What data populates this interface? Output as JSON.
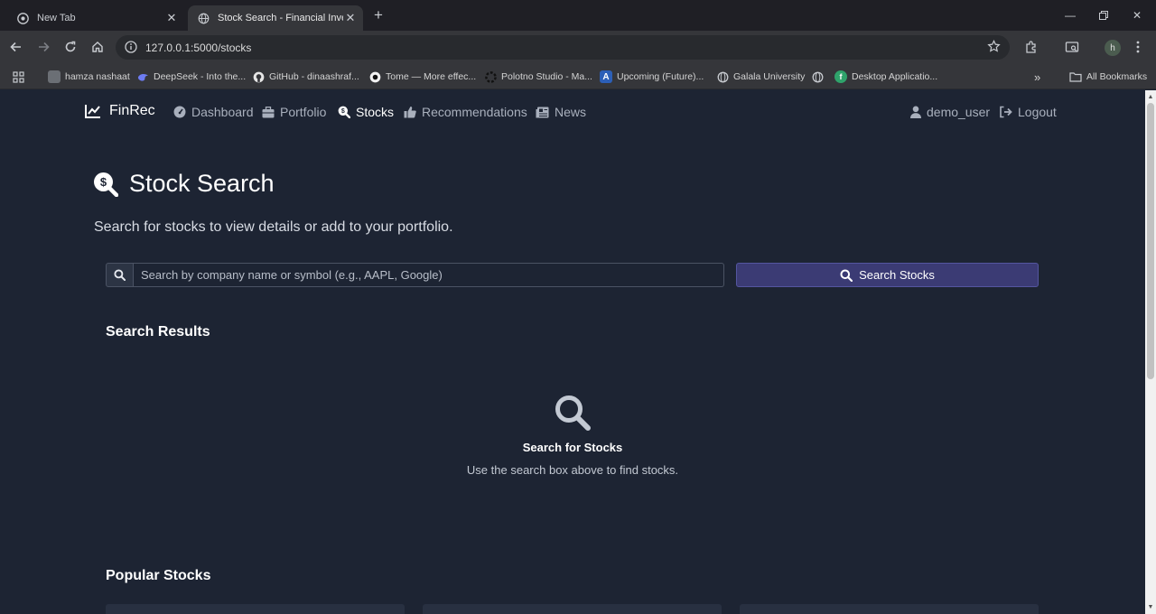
{
  "browser": {
    "tabs": [
      {
        "title": "New Tab"
      },
      {
        "title": "Stock Search - Financial Investm"
      }
    ],
    "url": "127.0.0.1:5000/stocks",
    "profile_initial": "h",
    "bookmarks": [
      {
        "label": "hamza nashaat",
        "icon": "image-icon"
      },
      {
        "label": "DeepSeek - Into the...",
        "icon": "deepseek-icon"
      },
      {
        "label": "GitHub - dinaashraf...",
        "icon": "github-icon"
      },
      {
        "label": "Tome — More effec...",
        "icon": "tome-icon"
      },
      {
        "label": "Polotno Studio - Ma...",
        "icon": "polotno-icon"
      },
      {
        "label": "Upcoming (Future)...",
        "icon": "upcoming-icon"
      },
      {
        "label": "Galala University",
        "icon": "globe-icon"
      },
      {
        "label": "Desktop Applicatio...",
        "icon": "desktop-app-icon"
      }
    ],
    "all_bookmarks_label": "All Bookmarks"
  },
  "nav": {
    "brand": "FinRec",
    "links": [
      {
        "label": "Dashboard",
        "icon": "dashboard-icon"
      },
      {
        "label": "Portfolio",
        "icon": "briefcase-icon"
      },
      {
        "label": "Stocks",
        "icon": "search-dollar-icon"
      },
      {
        "label": "Recommendations",
        "icon": "thumbs-up-icon"
      },
      {
        "label": "News",
        "icon": "newspaper-icon"
      }
    ],
    "user": "demo_user",
    "logout": "Logout"
  },
  "page": {
    "title": "Stock Search",
    "lead": "Search for stocks to view details or add to your portfolio.",
    "search": {
      "placeholder": "Search by company name or symbol (e.g., AAPL, Google)",
      "value": "",
      "button": "Search Stocks"
    },
    "results": {
      "heading": "Search Results",
      "empty_title": "Search for Stocks",
      "empty_text": "Use the search box above to find stocks."
    },
    "popular_heading": "Popular Stocks"
  },
  "colors": {
    "page_bg": "#1d2433",
    "accent_button": "#3b3b74",
    "text_muted": "#a9b0bd"
  }
}
